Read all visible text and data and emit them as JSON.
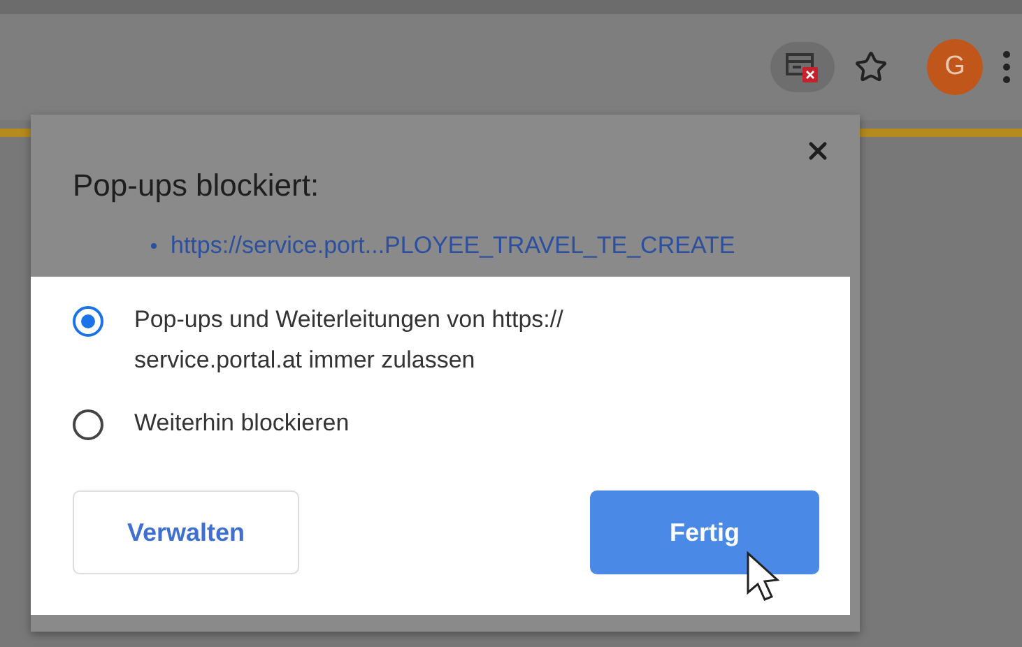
{
  "toolbar": {
    "avatar": "G"
  },
  "popup": {
    "title": "Pop-ups blockiert:",
    "links": [
      "https://service.port...PLOYEE_TRAVEL_TE_CREATE"
    ],
    "options": [
      {
        "label": "Pop-ups und Weiterleitungen von https://\nservice.portal.at immer zulassen",
        "selected": true
      },
      {
        "label": "Weiterhin blockieren",
        "selected": false
      }
    ],
    "buttons": [
      {
        "label": "Verwalten",
        "kind": "secondary"
      },
      {
        "label": "Fertig",
        "kind": "primary"
      }
    ]
  }
}
